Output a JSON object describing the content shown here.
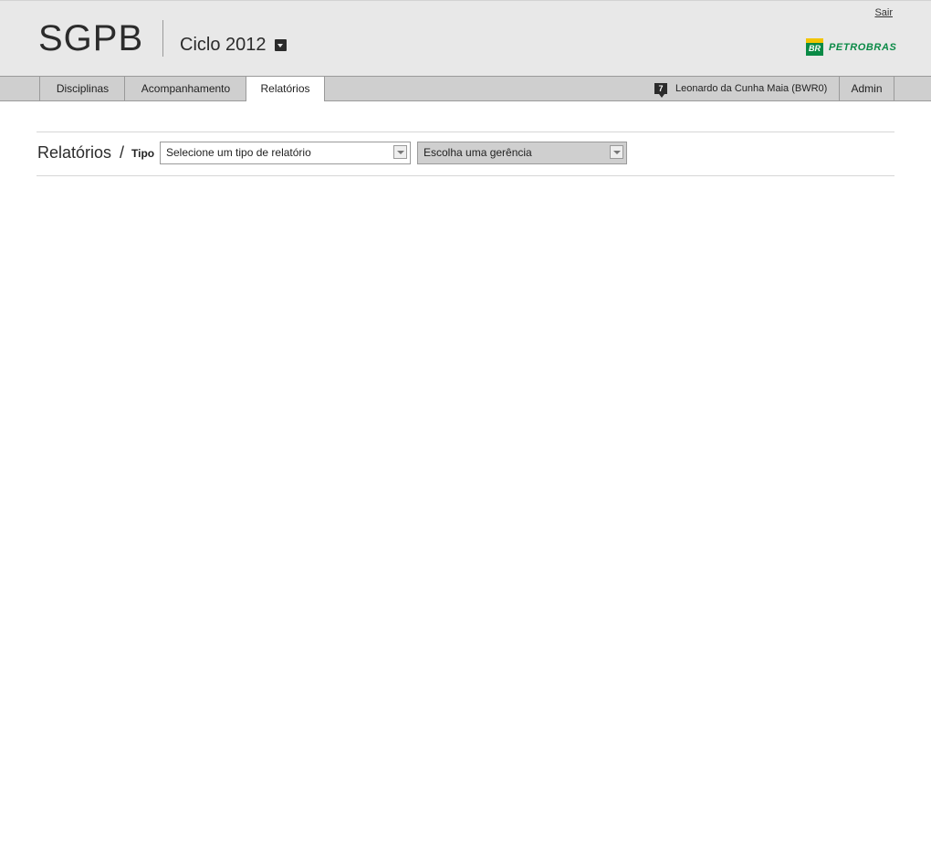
{
  "header": {
    "app_title": "SGPB",
    "cycle": "Ciclo 2012",
    "logout": "Sair",
    "logo": {
      "mark_text": "BR",
      "name": "PETROBRAS",
      "colors": {
        "yellow": "#f2c500",
        "green": "#0a8a46"
      }
    }
  },
  "nav": {
    "tabs": [
      {
        "label": "Disciplinas",
        "active": false
      },
      {
        "label": "Acompanhamento",
        "active": false
      },
      {
        "label": "Relatórios",
        "active": true
      }
    ],
    "notifications": "7",
    "user": "Leonardo da Cunha Maia (BWR0)",
    "admin": "Admin"
  },
  "main": {
    "title": "Relatórios",
    "separator": "/",
    "tipo_label": "Tipo",
    "report_type_select": "Selecione um tipo de relatório",
    "management_select": "Escolha uma gerência"
  }
}
